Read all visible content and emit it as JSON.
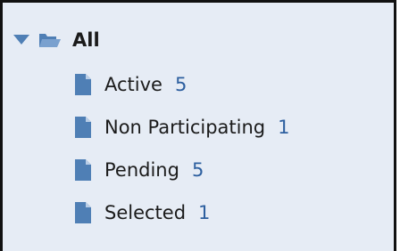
{
  "tree": {
    "root": {
      "label": "All",
      "expanded": true
    },
    "children": [
      {
        "label": "Active",
        "count": "5"
      },
      {
        "label": "Non Participating",
        "count": "1"
      },
      {
        "label": "Pending",
        "count": "5"
      },
      {
        "label": "Selected",
        "count": "1"
      }
    ]
  },
  "colors": {
    "panel_background": "#e6ecf5",
    "icon": "#4f7fb5",
    "count_text": "#2d5f9f",
    "border": "#111111"
  },
  "icons": {
    "expander": "caret-down-icon",
    "root": "open-folder-icon",
    "child": "document-icon"
  }
}
